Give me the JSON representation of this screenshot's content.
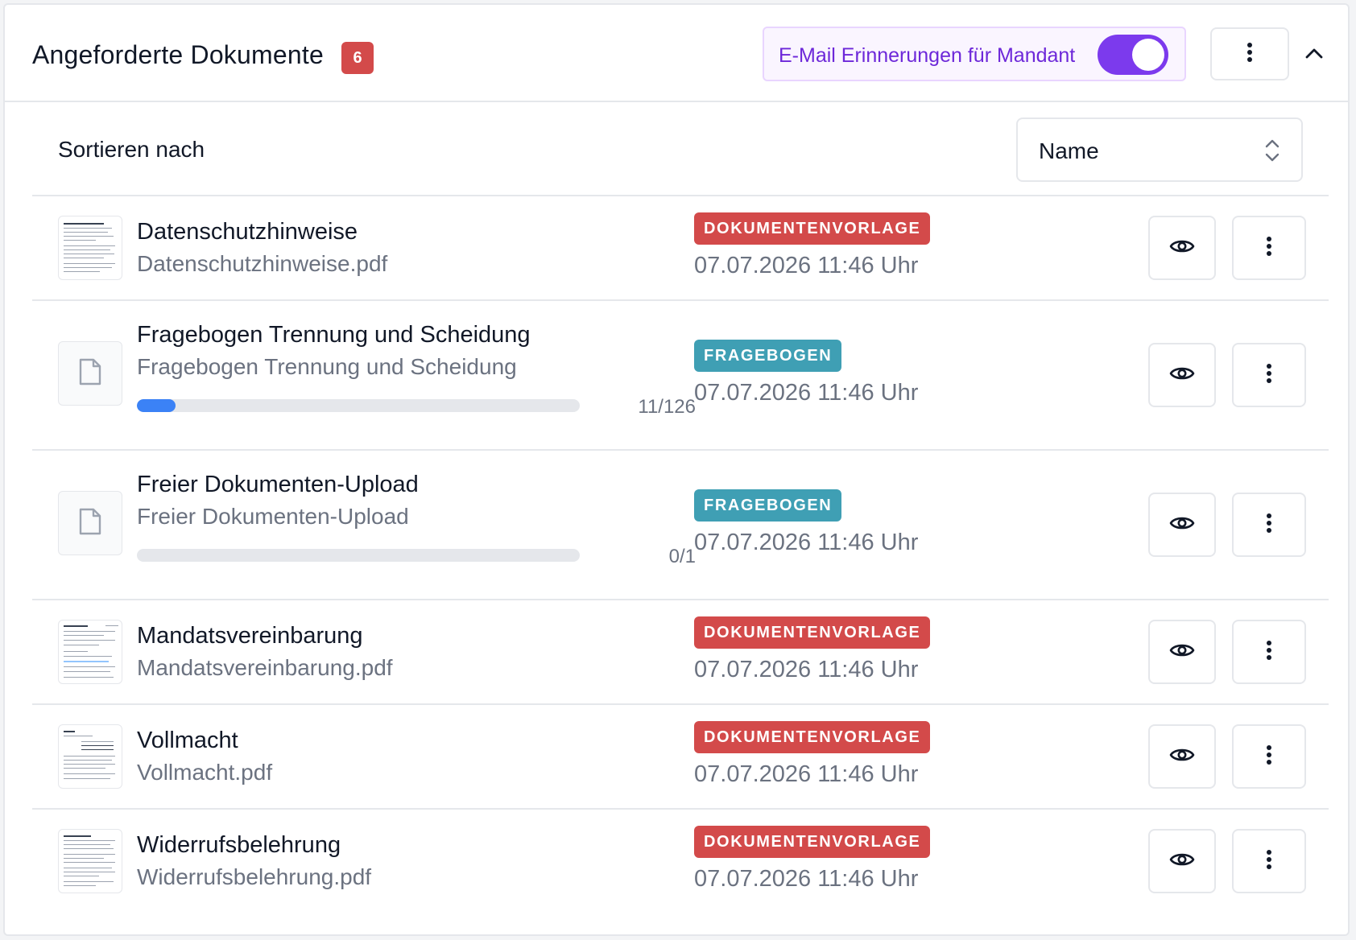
{
  "header": {
    "title": "Angeforderte Dokumente",
    "count": "6",
    "reminder_label": "E-Mail Erinnerungen für Mandant",
    "reminder_enabled": true
  },
  "sort": {
    "label": "Sortieren nach",
    "value": "Name"
  },
  "documents": [
    {
      "name": "Datenschutzhinweise",
      "file": "Datenschutzhinweise.pdf",
      "type": "DOKUMENTENVORLAGE",
      "date": "07.07.2026 11:46 Uhr",
      "thumbnail": "pdf-preview"
    },
    {
      "name": "Fragebogen Trennung und Scheidung",
      "file": "Fragebogen Trennung und Scheidung",
      "type": "FRAGEBOGEN",
      "date": "07.07.2026 11:46 Uhr",
      "thumbnail": "file-icon",
      "progress_text": "11/126",
      "progress": 0.087
    },
    {
      "name": "Freier Dokumenten-Upload",
      "file": "Freier Dokumenten-Upload",
      "type": "FRAGEBOGEN",
      "date": "07.07.2026 11:46 Uhr",
      "thumbnail": "file-icon",
      "progress_text": "0/1",
      "progress": 0
    },
    {
      "name": "Mandatsvereinbarung",
      "file": "Mandatsvereinbarung.pdf",
      "type": "DOKUMENTENVORLAGE",
      "date": "07.07.2026 11:46 Uhr",
      "thumbnail": "pdf-preview"
    },
    {
      "name": "Vollmacht",
      "file": "Vollmacht.pdf",
      "type": "DOKUMENTENVORLAGE",
      "date": "07.07.2026 11:46 Uhr",
      "thumbnail": "pdf-preview"
    },
    {
      "name": "Widerrufsbelehrung",
      "file": "Widerrufsbelehrung.pdf",
      "type": "DOKUMENTENVORLAGE",
      "date": "07.07.2026 11:46 Uhr",
      "thumbnail": "pdf-preview"
    }
  ],
  "colors": {
    "accent": "#7c3aed",
    "badge_red": "#d34a4a",
    "badge_teal": "#3f9fb4",
    "progress": "#3b82f6"
  },
  "icons": {
    "eye": "eye-icon",
    "more": "more-vertical-icon",
    "collapse": "chevron-up-icon",
    "sort": "chevrons-up-down-icon",
    "file": "file-icon"
  }
}
